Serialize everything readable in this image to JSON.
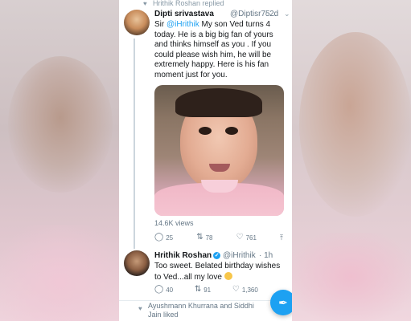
{
  "context": {
    "replied_label": "Hrithik Roshan replied",
    "liked_label": "Ayushmann Khurrana and Siddhi Jain liked"
  },
  "tweet1": {
    "name": "Dipti srivastava",
    "handle": "@Diptisr75...",
    "time": "· 2d",
    "text_before_mention": "Sir ",
    "mention": "@iHrithik",
    "text_after_mention": " My son Ved turns 4 today. He is a big big fan of yours and thinks himself as you . If you could please wish him, he will be extremely happy. Here is his fan moment just for you.",
    "views": "14.6K views",
    "replies": "25",
    "retweets": "78",
    "likes": "761"
  },
  "tweet2": {
    "name": "Hrithik Roshan",
    "handle": "@iHrithik",
    "time": "· 1h",
    "text": "Too sweet. Belated birthday wishes to Ved...all my love",
    "replies": "40",
    "retweets": "91",
    "likes": "1,360"
  },
  "icons": {
    "reply": "reply-icon",
    "retweet": "retweet-icon",
    "like": "heart-icon",
    "share": "share-icon",
    "compose": "compose-tweet-icon",
    "verified": "verified-badge-icon",
    "chevron": "chevron-down-icon"
  },
  "colors": {
    "accent": "#1da1f2",
    "text": "#14171a",
    "muted": "#657786"
  }
}
